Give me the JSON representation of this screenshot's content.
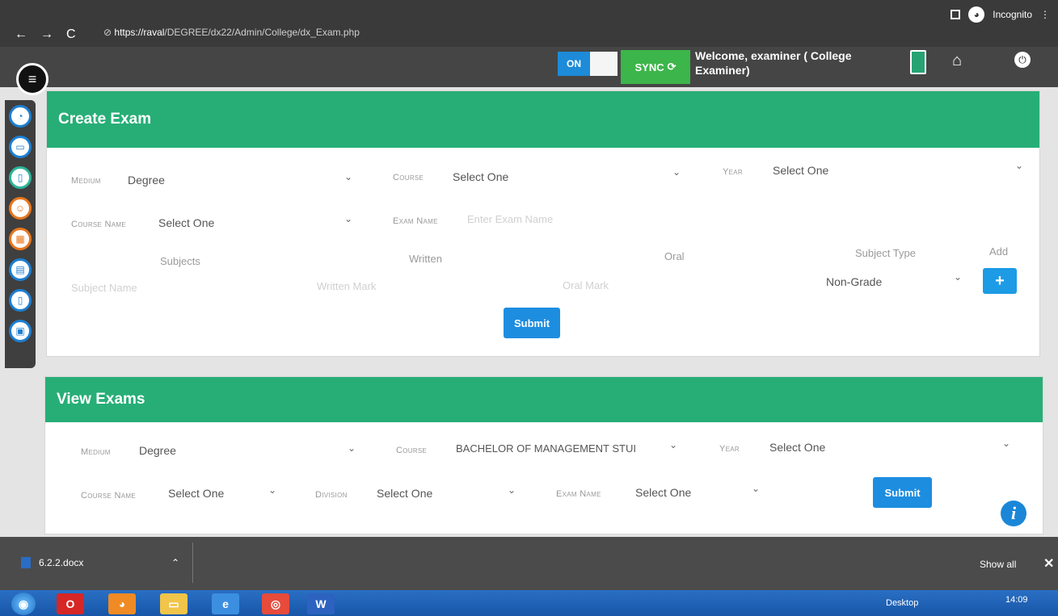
{
  "browser": {
    "url_host": "https://raval",
    "url_path": "/DEGREE/dx22/Admin/College/dx_Exam.php",
    "incognito_label": "Incognito"
  },
  "header": {
    "toggle_label": "ON",
    "sync_label": "SYNC",
    "welcome_text": "Welcome, examiner ( College Examiner)"
  },
  "create_exam": {
    "title": "Create Exam",
    "medium_label": "Medium",
    "medium_value": "Degree",
    "course_label": "Course",
    "course_value": "Select One",
    "year_label": "Year",
    "year_value": "Select One",
    "course_name_label": "Course Name",
    "course_name_value": "Select One",
    "exam_name_label": "Exam Name",
    "exam_name_placeholder": "Enter Exam Name",
    "col_subjects": "Subjects",
    "col_written": "Written",
    "col_oral": "Oral",
    "col_subject_type": "Subject Type",
    "col_add": "Add",
    "subject_placeholder": "Subject Name",
    "written_placeholder": "Written Mark",
    "oral_placeholder": "Oral Mark",
    "subject_type_value": "Non-Grade",
    "add_symbol": "+",
    "submit_label": "Submit"
  },
  "view_exams": {
    "title": "View Exams",
    "medium_label": "Medium",
    "medium_value": "Degree",
    "course_label": "Course",
    "course_value": "BACHELOR OF MANAGEMENT STUI",
    "year_label": "Year",
    "year_value": "Select One",
    "course_name_label": "Course Name",
    "course_name_value": "Select One",
    "division_label": "Division",
    "division_value": "Select One",
    "exam_name_label": "Exam Name",
    "exam_name_value": "Select One",
    "submit_label": "Submit"
  },
  "download_bar": {
    "file_name": "6.2.2.docx",
    "show_all": "Show all"
  },
  "taskbar": {
    "desktop_label": "Desktop",
    "time": "14:09"
  },
  "colors": {
    "header_green": "#27ae76",
    "button_blue": "#1d8de0",
    "sync_green": "#3cb54a"
  }
}
